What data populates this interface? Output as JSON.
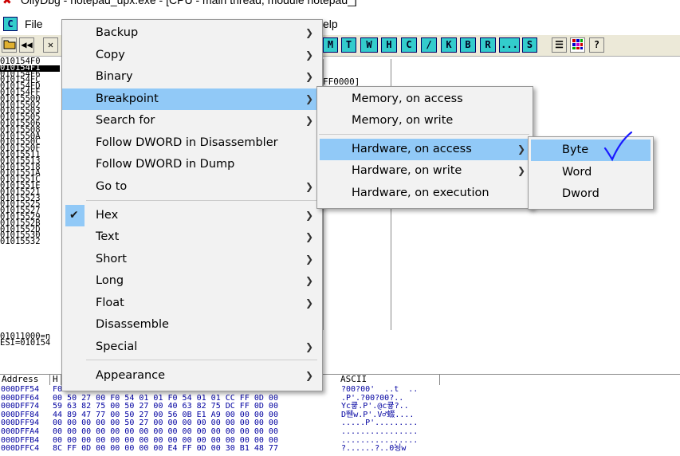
{
  "window": {
    "title": "OllyDbg - notepad_upx.exe - [CPU - main thread, module notepad_]"
  },
  "menubar": {
    "icon_label": "C",
    "file": "File",
    "help": "elp"
  },
  "toolbar": {
    "left_buttons": [
      "open-icon",
      "rewind-icon",
      "close-icon"
    ],
    "letter_buttons": [
      "M",
      "T",
      "W",
      "H",
      "C",
      "/",
      "K",
      "B",
      "R",
      "...",
      "S"
    ]
  },
  "cpu": {
    "addresses": [
      "010154F0",
      "010154F1",
      "010154F6",
      "010154FC",
      "010154FD",
      "010154FF",
      "01015500",
      "01015502",
      "01015503",
      "01015505",
      "01015506",
      "01015508",
      "0101550A",
      "0101550C",
      "0101550F",
      "01015511",
      "01015513",
      "01015518",
      "0101551A",
      "0101551C",
      "0101551E",
      "01015521",
      "01015523",
      "01015525",
      "01015527",
      "01015529",
      "0101552B",
      "0101552D",
      "01015530",
      "01015532"
    ],
    "selected_index": 1,
    "register_snippet": "FF0000]"
  },
  "status": {
    "line1": "01011000=n",
    "line2": "ESI=010154"
  },
  "dump": {
    "headers": [
      "Address",
      "H",
      "ASCII"
    ],
    "rows": [
      {
        "addr": "000DFF54",
        "hex": "F0 ...",
        "ascii": "?00?00'  ..t  .."
      },
      {
        "addr": "000DFF64",
        "hex": "00 50 27 00 F0 54 01 01 F0 54 01 01 CC FF 0D 00",
        "ascii": ".P'.?00?00?.."
      },
      {
        "addr": "000DFF74",
        "hex": "59 63 82 75 00 50 27 00 40 63 82 75 DC FF 0D 00",
        "ascii": "Yc큫.P'.@c큫?.."
      },
      {
        "addr": "000DFF84",
        "hex": "44 89 47 77 00 50 27 00 56 0B E1 A9 00 00 00 00",
        "ascii": "D뛘w.P'.V♂蝃...."
      },
      {
        "addr": "000DFF94",
        "hex": "00 00 00 00 00 50 27 00 00 00 00 00 00 00 00 00",
        "ascii": ".....P'........."
      },
      {
        "addr": "000DFFA4",
        "hex": "00 00 00 00 00 00 00 00 00 00 00 00 00 00 00 00",
        "ascii": "................"
      },
      {
        "addr": "000DFFB4",
        "hex": "00 00 00 00 00 00 00 00 00 00 00 00 00 00 00 00",
        "ascii": "................"
      },
      {
        "addr": "000DFFC4",
        "hex": "8C FF 0D 00 00 00 00 00 E4 FF 0D 00 30 B1 48 77",
        "ascii": "?......?..0뇡w"
      }
    ]
  },
  "context_menu": {
    "items": [
      {
        "label": "Backup",
        "submenu": true
      },
      {
        "label": "Copy",
        "submenu": true
      },
      {
        "label": "Binary",
        "submenu": true
      },
      {
        "label": "Breakpoint",
        "submenu": true,
        "highlighted": true
      },
      {
        "label": "Search for",
        "submenu": true
      },
      {
        "label": "Follow DWORD in Disassembler",
        "submenu": false
      },
      {
        "label": "Follow DWORD in Dump",
        "submenu": false
      },
      {
        "label": "Go to",
        "submenu": true
      },
      {
        "label": "Hex",
        "submenu": true,
        "checked": true
      },
      {
        "label": "Text",
        "submenu": true
      },
      {
        "label": "Short",
        "submenu": true
      },
      {
        "label": "Long",
        "submenu": true
      },
      {
        "label": "Float",
        "submenu": true
      },
      {
        "label": "Disassemble",
        "submenu": false
      },
      {
        "label": "Special",
        "submenu": true
      },
      {
        "label": "Appearance",
        "submenu": true
      }
    ]
  },
  "breakpoint_submenu": {
    "items": [
      {
        "label": "Memory, on access",
        "submenu": false
      },
      {
        "label": "Memory, on write",
        "submenu": false
      },
      {
        "label": "Hardware, on access",
        "submenu": true,
        "highlighted": true
      },
      {
        "label": "Hardware, on write",
        "submenu": true
      },
      {
        "label": "Hardware, on execution",
        "submenu": false
      }
    ]
  },
  "hardware_submenu": {
    "items": [
      {
        "label": "Byte",
        "highlighted": true
      },
      {
        "label": "Word"
      },
      {
        "label": "Dword"
      }
    ]
  },
  "colors": {
    "highlight": "#91c9f7",
    "menu_bg": "#f2f2f2",
    "toolbar_letter": "#33cccc",
    "annotation": "#1a1aff"
  }
}
